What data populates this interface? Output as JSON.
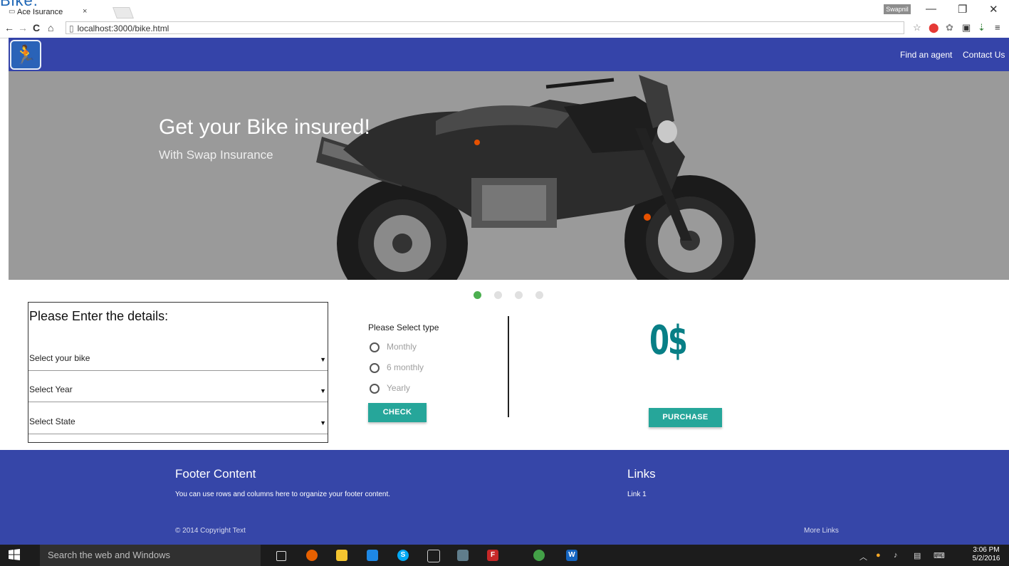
{
  "overlay_text": "Bike.",
  "browser": {
    "tab_title": "Ace Isurance",
    "tab_close": "×",
    "tab_icon": "page-icon",
    "user_chip": "Swapnil",
    "window_controls": [
      "—",
      "❐",
      "✕"
    ],
    "nav": {
      "back": "←",
      "forward": "→",
      "reload": "C",
      "home": "⌂"
    },
    "url": "localhost:3000/bike.html"
  },
  "site": {
    "logo_glyph": "🏃",
    "nav_links": [
      "Find an agent",
      "Contact Us"
    ],
    "hero": {
      "title": "Get your Bike insured!",
      "subtitle": "With Swap Insurance"
    }
  },
  "form": {
    "title": "Please Enter the details:",
    "selects": [
      "Select your bike",
      "Select Year",
      "Select State"
    ],
    "type_label": "Please Select type",
    "options": [
      "Monthly",
      "6 monthly",
      "Yearly"
    ],
    "check_button": "CHECK",
    "price": "0$",
    "purchase_button": "PURCHASE"
  },
  "carousel": {
    "total": 4,
    "active_index": 0
  },
  "footer": {
    "content_title": "Footer Content",
    "content_text": "You can use rows and columns here to organize your footer content.",
    "links_title": "Links",
    "links": [
      "Link 1"
    ],
    "copyright": "© 2014 Copyright Text",
    "more_links": "More Links"
  },
  "taskbar": {
    "search_placeholder": "Search the web and Windows",
    "time": "3:06 PM",
    "date": "5/2/2016"
  },
  "colors": {
    "nav_bg": "#3544a9",
    "accent_teal": "#26a69a",
    "price_color": "#087f86",
    "dot_active": "#4caf50"
  }
}
